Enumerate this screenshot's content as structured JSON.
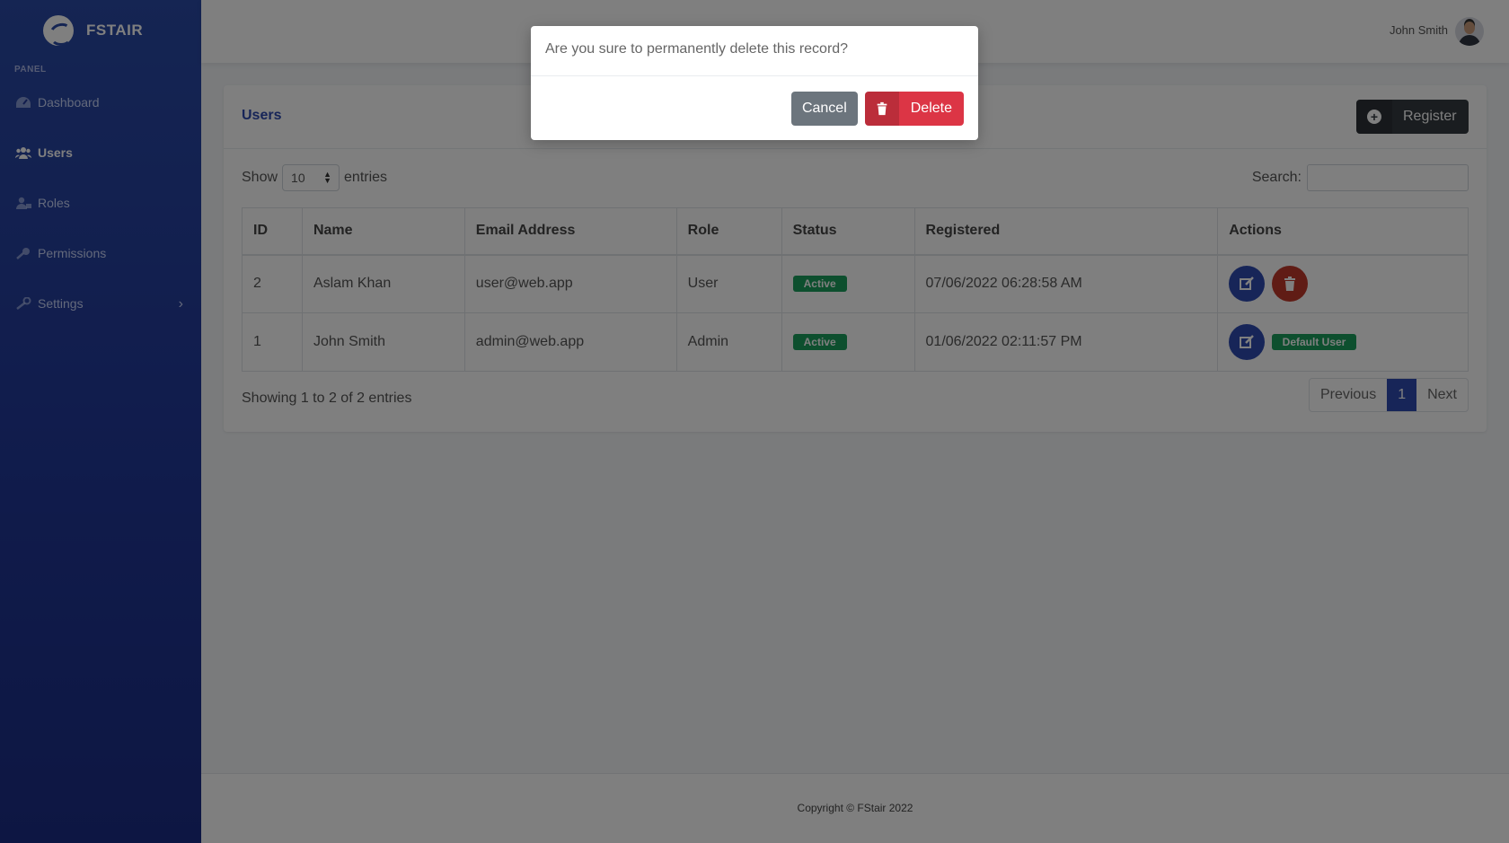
{
  "brand": {
    "name": "FSTAIR"
  },
  "sidebar": {
    "section_label": "PANEL",
    "items": [
      {
        "label": "Dashboard",
        "icon": "dashboard-icon"
      },
      {
        "label": "Users",
        "icon": "users-icon",
        "active": true
      },
      {
        "label": "Roles",
        "icon": "user-tag-icon"
      },
      {
        "label": "Permissions",
        "icon": "key-icon"
      },
      {
        "label": "Settings",
        "icon": "wrench-icon",
        "chevron": "›"
      }
    ]
  },
  "topbar": {
    "user_name": "John Smith"
  },
  "card": {
    "title": "Users",
    "register_label": "Register",
    "show_label": "Show",
    "entries_label": "entries",
    "page_length": "10",
    "search_label": "Search:",
    "search_value": ""
  },
  "table": {
    "headers": [
      "ID",
      "Name",
      "Email Address",
      "Role",
      "Status",
      "Registered",
      "Actions"
    ],
    "rows": [
      {
        "id": "2",
        "name": "Aslam Khan",
        "email": "user@web.app",
        "role": "User",
        "status": "Active",
        "registered": "07/06/2022 06:28:58 AM"
      },
      {
        "id": "1",
        "name": "John Smith",
        "email": "admin@web.app",
        "role": "Admin",
        "status": "Active",
        "registered": "01/06/2022 02:11:57 PM",
        "tag": "Default User"
      }
    ]
  },
  "pagination": {
    "info": "Showing 1 to 2 of 2 entries",
    "previous": "Previous",
    "current": "1",
    "next": "Next"
  },
  "footer": {
    "text": "Copyright © FStair 2022"
  },
  "modal": {
    "message": "Are you sure to permanently delete this record?",
    "cancel_label": "Cancel",
    "delete_label": "Delete"
  },
  "colors": {
    "primary": "#2f4bb0",
    "danger": "#dc3545",
    "success": "#1a9e5c",
    "dark": "#343a40",
    "secondary": "#6c757d"
  }
}
